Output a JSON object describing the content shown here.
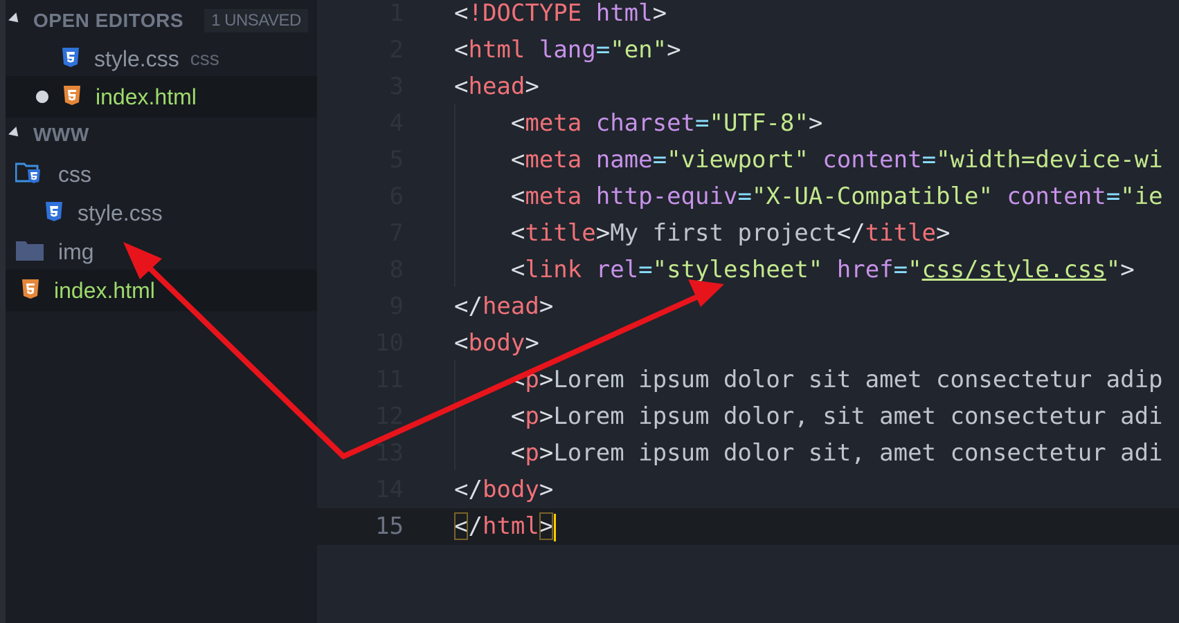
{
  "sidebar": {
    "open_editors": {
      "title": "OPEN EDITORS",
      "badge": "1 UNSAVED",
      "items": [
        {
          "name": "style.css",
          "ext": "css",
          "icon": "css3-icon"
        },
        {
          "name": "index.html",
          "icon": "html5-icon",
          "unsaved": true
        }
      ]
    },
    "folder": {
      "title": "WWW",
      "items": [
        {
          "name": "css",
          "icon": "css-folder-icon"
        },
        {
          "name": "style.css",
          "icon": "css3-icon"
        },
        {
          "name": "img",
          "icon": "folder-icon"
        },
        {
          "name": "index.html",
          "icon": "html5-icon"
        }
      ]
    }
  },
  "editor": {
    "current_line": 15,
    "lines": [
      {
        "n": "1",
        "tokens": [
          [
            "br",
            "<"
          ],
          [
            "tag",
            "!DOCTYPE"
          ],
          [
            "br",
            " "
          ],
          [
            "attr",
            "html"
          ],
          [
            "br",
            ">"
          ]
        ]
      },
      {
        "n": "2",
        "tokens": [
          [
            "br",
            "<"
          ],
          [
            "tag",
            "html"
          ],
          [
            "br",
            " "
          ],
          [
            "attr",
            "lang"
          ],
          [
            "eq",
            "="
          ],
          [
            "str",
            "\"en\""
          ],
          [
            "br",
            ">"
          ]
        ]
      },
      {
        "n": "3",
        "tokens": [
          [
            "br",
            "<"
          ],
          [
            "tag",
            "head"
          ],
          [
            "br",
            ">"
          ]
        ]
      },
      {
        "n": "4",
        "tokens": [
          [
            "br",
            "    <"
          ],
          [
            "tag",
            "meta"
          ],
          [
            "br",
            " "
          ],
          [
            "attr",
            "charset"
          ],
          [
            "eq",
            "="
          ],
          [
            "str",
            "\"UTF-8\""
          ],
          [
            "br",
            ">"
          ]
        ]
      },
      {
        "n": "5",
        "tokens": [
          [
            "br",
            "    <"
          ],
          [
            "tag",
            "meta"
          ],
          [
            "br",
            " "
          ],
          [
            "attr",
            "name"
          ],
          [
            "eq",
            "="
          ],
          [
            "str",
            "\"viewport\""
          ],
          [
            "br",
            " "
          ],
          [
            "attr",
            "content"
          ],
          [
            "eq",
            "="
          ],
          [
            "str",
            "\"width=device-wi"
          ]
        ]
      },
      {
        "n": "6",
        "tokens": [
          [
            "br",
            "    <"
          ],
          [
            "tag",
            "meta"
          ],
          [
            "br",
            " "
          ],
          [
            "attr",
            "http-equiv"
          ],
          [
            "eq",
            "="
          ],
          [
            "str",
            "\"X-UA-Compatible\""
          ],
          [
            "br",
            " "
          ],
          [
            "attr",
            "content"
          ],
          [
            "eq",
            "="
          ],
          [
            "str",
            "\"ie"
          ]
        ]
      },
      {
        "n": "7",
        "tokens": [
          [
            "br",
            "    <"
          ],
          [
            "tag",
            "title"
          ],
          [
            "br",
            ">"
          ],
          [
            "txt",
            "My first project"
          ],
          [
            "br",
            "</"
          ],
          [
            "tag",
            "title"
          ],
          [
            "br",
            ">"
          ]
        ]
      },
      {
        "n": "8",
        "tokens": [
          [
            "br",
            "    <"
          ],
          [
            "tag",
            "link"
          ],
          [
            "br",
            " "
          ],
          [
            "attr",
            "rel"
          ],
          [
            "eq",
            "="
          ],
          [
            "str",
            "\"stylesheet\""
          ],
          [
            "br",
            " "
          ],
          [
            "attr",
            "href"
          ],
          [
            "eq",
            "="
          ],
          [
            "str",
            "\""
          ],
          [
            "link",
            "css/style.css"
          ],
          [
            "str",
            "\""
          ],
          [
            "br",
            ">"
          ]
        ]
      },
      {
        "n": "9",
        "tokens": [
          [
            "br",
            "</"
          ],
          [
            "tag",
            "head"
          ],
          [
            "br",
            ">"
          ]
        ]
      },
      {
        "n": "10",
        "tokens": [
          [
            "br",
            "<"
          ],
          [
            "tag",
            "body"
          ],
          [
            "br",
            ">"
          ]
        ]
      },
      {
        "n": "11",
        "tokens": [
          [
            "br",
            "    <"
          ],
          [
            "tag",
            "p"
          ],
          [
            "br",
            ">"
          ],
          [
            "txt",
            "Lorem ipsum dolor sit amet consectetur adip"
          ]
        ]
      },
      {
        "n": "12",
        "tokens": [
          [
            "br",
            "    <"
          ],
          [
            "tag",
            "p"
          ],
          [
            "br",
            ">"
          ],
          [
            "txt",
            "Lorem ipsum dolor, sit amet consectetur adi"
          ]
        ]
      },
      {
        "n": "13",
        "tokens": [
          [
            "br",
            "    <"
          ],
          [
            "tag",
            "p"
          ],
          [
            "br",
            ">"
          ],
          [
            "txt",
            "Lorem ipsum dolor sit, amet consectetur adi"
          ]
        ]
      },
      {
        "n": "14",
        "tokens": [
          [
            "br",
            "</"
          ],
          [
            "tag",
            "body"
          ],
          [
            "br",
            ">"
          ]
        ]
      },
      {
        "n": "15",
        "tokens": [
          [
            "match",
            "<"
          ],
          [
            "br",
            "/"
          ],
          [
            "tag",
            "html"
          ],
          [
            "match",
            ">"
          ]
        ]
      }
    ]
  },
  "colors": {
    "annotation_arrow": "#e8141c",
    "accent_caret": "#ffcc00"
  }
}
